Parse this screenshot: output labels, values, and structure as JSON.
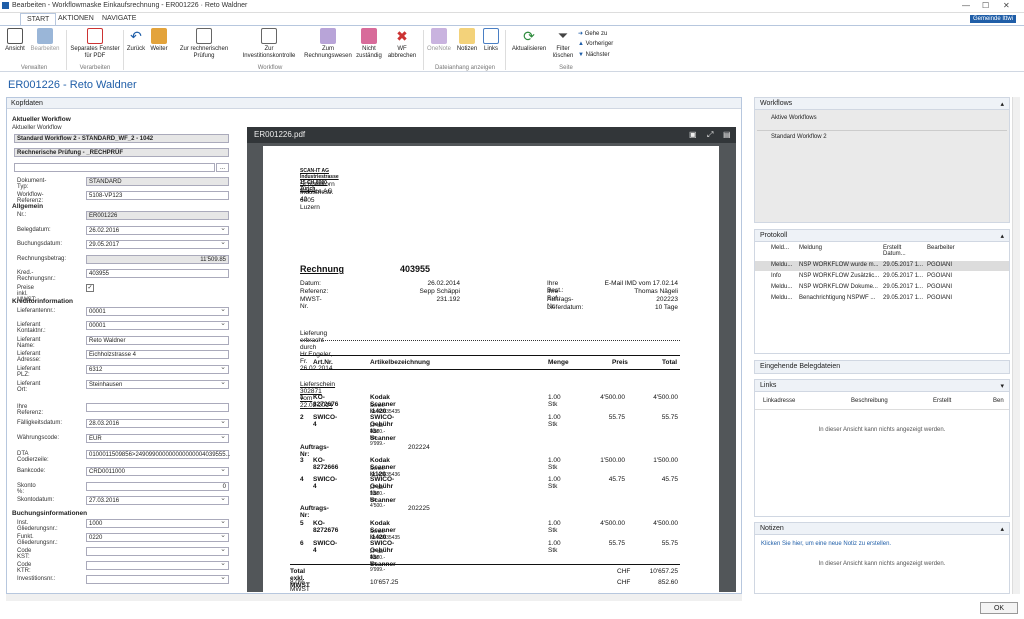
{
  "window": {
    "title": "Bearbeiten - Workflowmaske Einkaufsrechnung - ER001226 · Reto Waldner",
    "company": "Gemeinde Ittwi"
  },
  "tabs": [
    "START",
    "AKTIONEN",
    "NAVIGATE"
  ],
  "ribbon": {
    "buttons": [
      "Ansicht",
      "Bearbeiten",
      "Separates Fenster für PDF",
      "Zurück",
      "Weiter",
      "Zur rechnerischen Prüfung",
      "Zur Investitionskontrolle",
      "Zum Rechnungswesen",
      "Nicht zuständig",
      "WF abbrechen",
      "OneNote",
      "Notizen",
      "Links",
      "Aktualisieren",
      "Filter löschen",
      "Gehe zu",
      "Vorheriger",
      "Nächster"
    ],
    "groups": [
      "Verwalten",
      "Verarbeiten",
      "Workflow",
      "Dateianhang anzeigen",
      "Seite"
    ]
  },
  "page_title": "ER001226 - Reto Waldner",
  "left": {
    "header": "Kopfdaten",
    "wf_section": "Aktueller Workflow",
    "wf_label": "Aktueller Workflow",
    "wf_line1": "Standard Workflow 2 - STANDARD_WF_2 - 1042",
    "wf_line2": "Rechnerische Prüfung - _RECHPRÜF",
    "fields1": [
      {
        "l": "Dokument-Typ:",
        "v": "STANDARD"
      },
      {
        "l": "Workflow-Referenz:",
        "v": "5108-VP123"
      }
    ],
    "allg": "Allgemein",
    "fields2": [
      {
        "l": "Nr.:",
        "v": "ER001226"
      },
      {
        "l": "Belegdatum:",
        "v": "26.02.2016"
      },
      {
        "l": "Buchungsdatum:",
        "v": "29.05.2017"
      },
      {
        "l": "Rechnungsbetrag:",
        "v": "11'509.85"
      },
      {
        "l": "Kred.-Rechnungsnr.:",
        "v": "403955"
      },
      {
        "l": "Preise inkl. MWST:",
        "v": ""
      }
    ],
    "kred": "Kreditorinformation",
    "fields3": [
      {
        "l": "Lieferant Kontaktnr.:",
        "v": "00001"
      },
      {
        "l": "Lieferantennr.:",
        "v": "00001"
      },
      {
        "l": "Lieferant Name:",
        "v": "Reto Waldner"
      },
      {
        "l": "Lieferant Adresse:",
        "v": "Eichholzstrasse 4"
      },
      {
        "l": "Lieferant PLZ:",
        "v": "6312"
      },
      {
        "l": "Lieferant Ort:",
        "v": "Steinhausen"
      }
    ],
    "fields4": [
      {
        "l": "Ihre Referenz:",
        "v": ""
      },
      {
        "l": "Fälligkeitsdatum:",
        "v": "28.03.2016"
      },
      {
        "l": "Währungscode:",
        "v": "EUR"
      },
      {
        "l": "DTA Codierzeile:",
        "v": "0100011509856>249099000000000000004039555..."
      },
      {
        "l": "Bankcode:",
        "v": "CRD0011000"
      },
      {
        "l": "Skonto %:",
        "v": "0"
      },
      {
        "l": "Skontodatum:",
        "v": "27.03.2016"
      }
    ],
    "buch": "Buchungsinformationen",
    "fields5": [
      {
        "l": "Inst. Gliederungsnr.:",
        "v": "1000"
      },
      {
        "l": "Funkt. Gliederungsnr.:",
        "v": "0220"
      },
      {
        "l": "Code KST:",
        "v": ""
      },
      {
        "l": "Code KTR:",
        "v": ""
      },
      {
        "l": "Investitionsnr.:",
        "v": ""
      }
    ]
  },
  "pdf": {
    "filename": "ER001226.pdf",
    "sender": "SCAN-IT AG  Industriestrasse 15  CH-8000 Zürich",
    "recipient": [
      "Schneekorn Service AG",
      "Industriestr. 42",
      "6005 Luzern"
    ],
    "doc": "Rechnung",
    "docnr": "403955",
    "meta_l": [
      [
        "Datum:",
        "26.02.2014"
      ],
      [
        "Referenz:",
        "Sepp Schäppi"
      ],
      [
        "MWST-Nr.",
        "231.192"
      ]
    ],
    "meta_r": [
      [
        "Ihre Best.:",
        "E-Mail IMD  vom 17.02.14"
      ],
      [
        "Ihre Ref.:",
        "Thomas Nägeli"
      ],
      [
        "Auftrags-Nr:",
        "202223"
      ],
      [
        "Lieferdatum:",
        "10 Tage"
      ]
    ],
    "note": "Lieferung erbracht durch Hr.Engeler, Fr. 26.02.2014",
    "cols": [
      "Art.Nr.",
      "Artikelbezeichnung",
      "Menge",
      "Preis",
      "Total"
    ],
    "lieferschein": "Lieferschein 302871  vom  22.02.2014",
    "rows": [
      [
        "1",
        "KO-8272676",
        "Kodak Scanner i1420",
        "Serien-Nr.:45635435",
        "1.00 Stk",
        "4'500.00",
        "4'500.00"
      ],
      [
        "2",
        "SWICO-4",
        "SWICO-Gebühr für Scanner",
        "LP ab 4'500.- bis 9'999.-",
        "1.00 Stk",
        "55.75",
        "55.75"
      ],
      [
        "3",
        "KO-8272666",
        "Kodak Scanner i1120",
        "Serien-Nr.:45635436",
        "1.00 Stk",
        "1'500.00",
        "1'500.00"
      ],
      [
        "4",
        "SWICO-4",
        "SWICO-Gebühr für Scanner",
        "LP ab 1'500.- bis 4'500.-",
        "1.00 Stk",
        "45.75",
        "45.75"
      ],
      [
        "5",
        "KO-8272676",
        "Kodak Scanner i1420",
        "Serien-Nr.:45635435",
        "1.00 Stk",
        "4'500.00",
        "4'500.00"
      ],
      [
        "6",
        "SWICO-4",
        "SWICO-Gebühr für Scanner",
        "LP ab 4'500.- bis 9'999.-",
        "1.00 Stk",
        "55.75",
        "55.75"
      ]
    ],
    "auftrag1": "Auftrags-Nr:",
    "auftrag1v": "202224",
    "auftrag2": "Auftrags-Nr:",
    "auftrag2v": "202225",
    "total_l": "Total exkl. MWST",
    "total_c": "CHF",
    "total_v": "10'657.25",
    "mwst_l": "8.0%  MWST von",
    "mwst_b": "10'657.25",
    "mwst_c": "CHF",
    "mwst_v": "852.60"
  },
  "right": {
    "workflows": "Workflows",
    "aktive": "Aktive Workflows",
    "wf_item": "Standard Workflow 2",
    "protokoll": "Protokoll",
    "pcols": [
      "Meld...",
      "Meldung",
      "Erstellt Datum...",
      "Bearbeiter"
    ],
    "prows": [
      [
        "Meldu...",
        "NSP WORKFLOW wurde m...",
        "29.05.2017 1...",
        "PGOIANI"
      ],
      [
        "Info",
        "NSP WORKFLOW Zusätzlic...",
        "29.05.2017 1...",
        "PGOIANI"
      ],
      [
        "Meldu...",
        "NSP WORKFLOW Dokume...",
        "29.05.2017 1...",
        "PGOIANI"
      ],
      [
        "Meldu...",
        "Benachrichtigung NSPWF ...",
        "29.05.2017 1...",
        "PGOIANI"
      ]
    ],
    "eingehend": "Eingehende Belegdateien",
    "links": "Links",
    "lcols": [
      "Linkadresse",
      "Beschreibung",
      "Erstellt",
      "Ben"
    ],
    "empty": "In dieser Ansicht kann nichts angezeigt werden.",
    "notizen": "Notizen",
    "notiz_link": "Klicken Sie hier, um eine neue Notiz zu erstellen.",
    "empty2": "In dieser Ansicht kann nichts angezeigt werden."
  },
  "ok": "OK",
  "colors": {
    "accent": "#1f5ea8"
  }
}
